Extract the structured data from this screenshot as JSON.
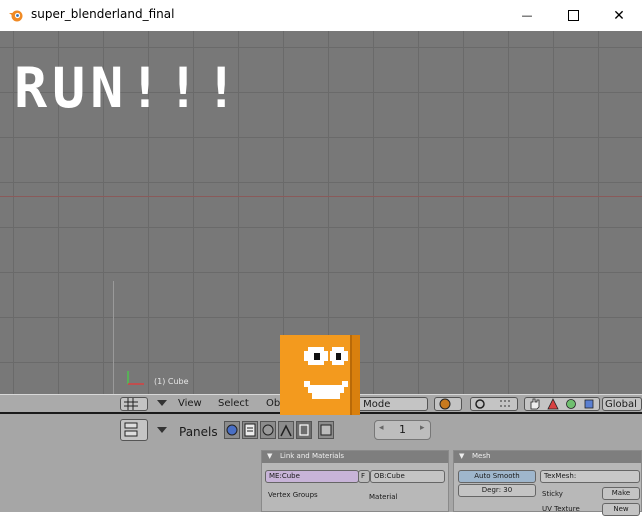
{
  "window": {
    "title": "super_blenderland_final",
    "minimize_symbol": "—",
    "close_symbol": "✕"
  },
  "viewport": {
    "banner_text": "RUN!!!",
    "object_label": "(1) Cube"
  },
  "header": {
    "menus": [
      "View",
      "Select",
      "Ob"
    ],
    "mode": "t Mode",
    "orientation": "Global"
  },
  "buttons_window": {
    "panels_label": "Panels",
    "frame": "1",
    "link_materials": {
      "title": "Link and Materials",
      "mesh_field": "ME:Cube",
      "f_label": "F",
      "object_field": "OB:Cube",
      "vertex_groups": "Vertex Groups",
      "material": "Material"
    },
    "mesh": {
      "title": "Mesh",
      "auto_smooth": "Auto Smooth",
      "degr": "Degr: 30",
      "texmesh": "TexMesh:",
      "sticky": "Sticky",
      "make": "Make",
      "uv_texture": "UV Texture",
      "new": "New"
    }
  },
  "colors": {
    "viewport_bg": "#787878",
    "character_orange": "#f39a1e",
    "header_bg": "#aaaaaa"
  }
}
